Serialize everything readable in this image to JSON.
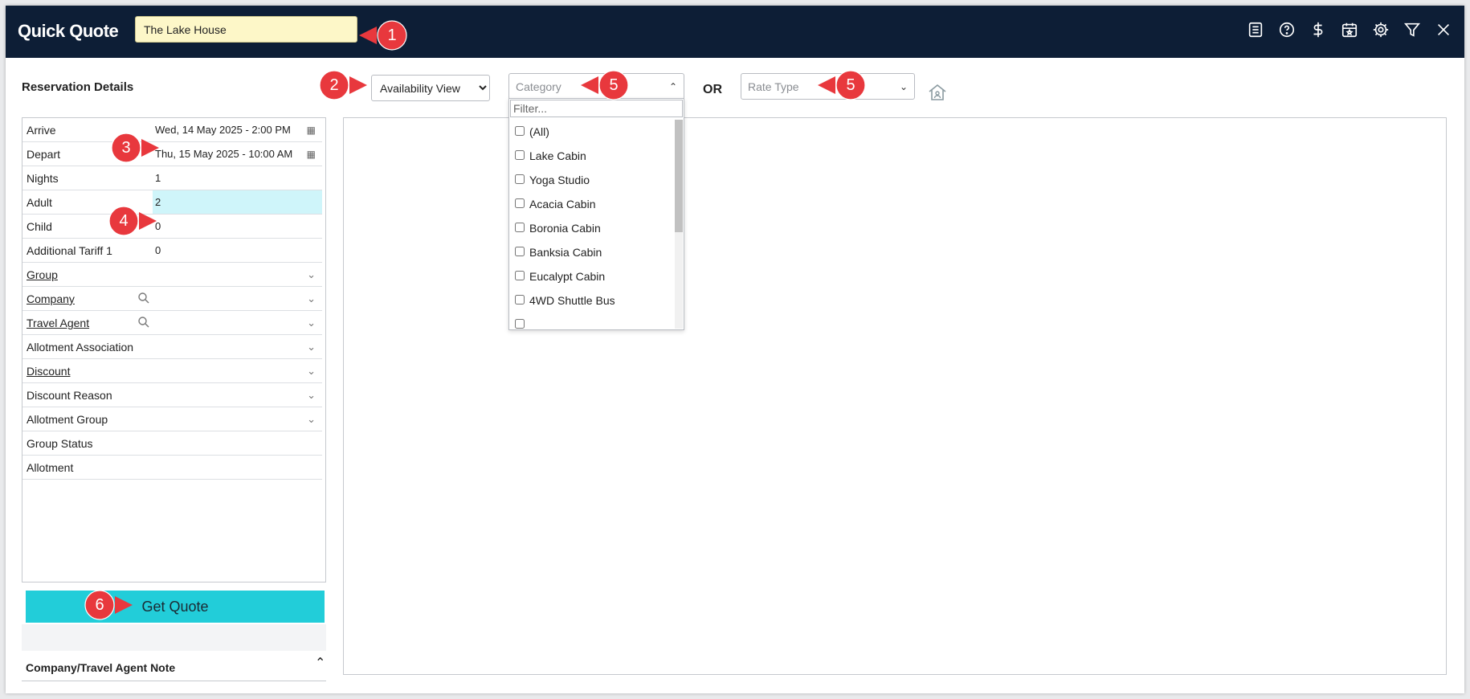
{
  "header": {
    "title": "Quick Quote",
    "property_value": "The Lake House",
    "icons": [
      "list-icon",
      "help-icon",
      "dollar-icon",
      "calendar-star-icon",
      "gear-icon",
      "filter-icon",
      "close-icon"
    ]
  },
  "callouts": [
    "1",
    "2",
    "3",
    "4",
    "5",
    "5",
    "6"
  ],
  "toolbar": {
    "section_title": "Reservation Details",
    "view_select": "Availability View",
    "category_placeholder": "Category",
    "or_label": "OR",
    "rate_type_placeholder": "Rate Type"
  },
  "category_popup": {
    "filter_placeholder": "Filter...",
    "options": [
      "(All)",
      "Lake Cabin",
      "Yoga Studio",
      "Acacia Cabin",
      "Boronia Cabin",
      "Banksia Cabin",
      "Eucalypt Cabin",
      "4WD Shuttle Bus"
    ]
  },
  "form": {
    "rows": [
      {
        "label": "Arrive",
        "value": "Wed, 14 May 2025 - 2:00 PM"
      },
      {
        "label": "Depart",
        "value": "Thu, 15 May 2025 - 10:00 AM"
      },
      {
        "label": "Nights",
        "value": "1"
      },
      {
        "label": "Adult",
        "value": "2"
      },
      {
        "label": "Child",
        "value": "0"
      },
      {
        "label": "Additional Tariff 1",
        "value": "0"
      },
      {
        "label": "Group",
        "value": ""
      },
      {
        "label": "Company",
        "value": ""
      },
      {
        "label": "Travel Agent",
        "value": ""
      },
      {
        "label": "Allotment Association",
        "value": ""
      },
      {
        "label": "Discount",
        "value": ""
      },
      {
        "label": "Discount Reason",
        "value": ""
      },
      {
        "label": "Allotment Group",
        "value": ""
      },
      {
        "label": "Group Status",
        "value": ""
      },
      {
        "label": "Allotment",
        "value": ""
      }
    ]
  },
  "actions": {
    "get_quote": "Get Quote"
  },
  "note": {
    "title": "Company/Travel Agent Note"
  },
  "colors": {
    "header_bg": "#0d1e36",
    "accent": "#22cdd9",
    "callout": "#e8383d",
    "property_bg": "#fdf7c8",
    "highlight": "#cff5fa"
  }
}
